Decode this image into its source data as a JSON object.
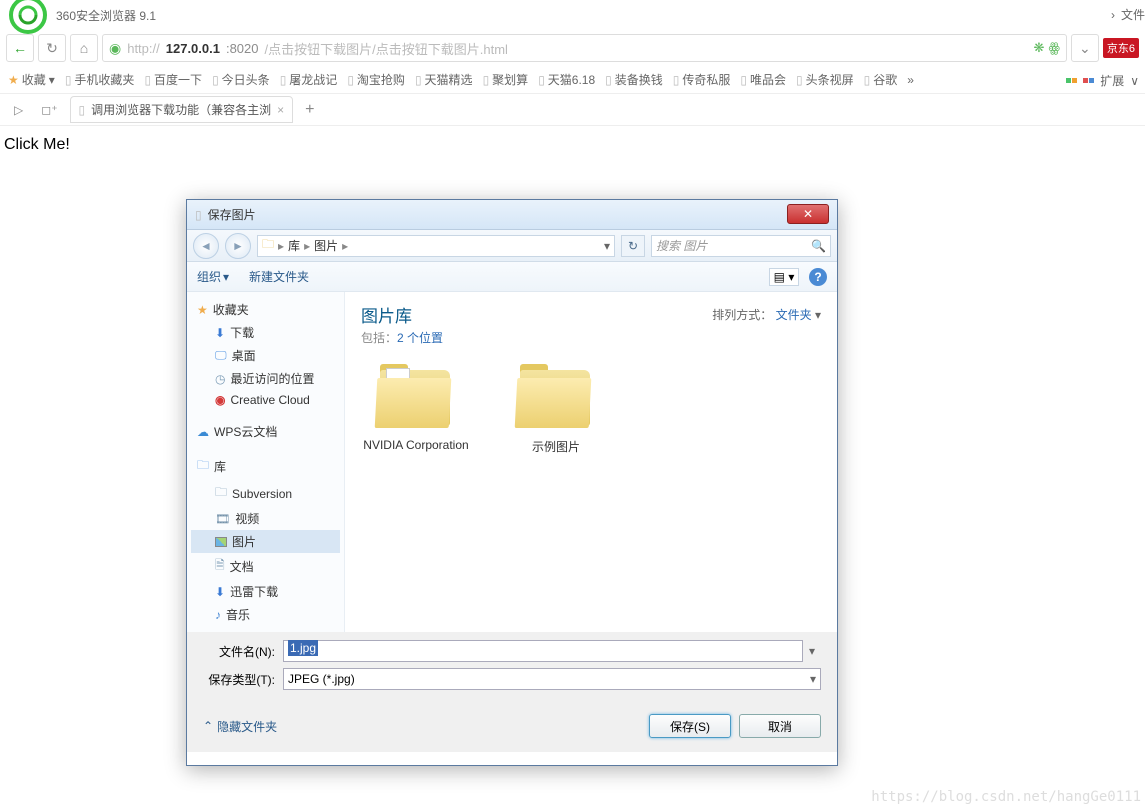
{
  "browser": {
    "title": "360安全浏览器 9.1",
    "top_right_file": "文件",
    "url_prefix": "http://",
    "url_host": "127.0.0.1",
    "url_port": ":8020",
    "url_path": "/点击按钮下载图片/点击按钮下载图片.html",
    "jd_label": "京东6"
  },
  "bookmarks": {
    "fav": "收藏",
    "items": [
      "手机收藏夹",
      "百度一下",
      "今日头条",
      "屠龙战记",
      "淘宝抢购",
      "天猫精选",
      "聚划算",
      "天猫6.18",
      "装备换钱",
      "传奇私服",
      "唯品会",
      "头条视屏",
      "谷歌"
    ],
    "more": "»",
    "ext": "扩展",
    "ext_arrow": "∨"
  },
  "tab": {
    "label": "调用浏览器下载功能（兼容各主浏",
    "new": "+"
  },
  "page": {
    "link": "Click Me!"
  },
  "dialog": {
    "title": "保存图片",
    "breadcrumb": {
      "lib": "库",
      "pics": "图片"
    },
    "search_placeholder": "搜索 图片",
    "tools": {
      "org": "组织",
      "newfolder": "新建文件夹"
    },
    "tree": {
      "fav": "收藏夹",
      "dl": "下载",
      "desk": "桌面",
      "recent": "最近访问的位置",
      "cc": "Creative Cloud",
      "wps": "WPS云文档",
      "lib": "库",
      "sv": "Subversion",
      "video": "视频",
      "pic": "图片",
      "doc": "文档",
      "xl": "迅雷下载",
      "music": "音乐"
    },
    "content": {
      "title": "图片库",
      "sub_prefix": "包括：",
      "sub_link": "2 个位置",
      "sort_label": "排列方式：",
      "sort_value": "文件夹",
      "folders": [
        "NVIDIA Corporation",
        "示例图片"
      ]
    },
    "fields": {
      "name_label": "文件名(N):",
      "name_value": "1.jpg",
      "type_label": "保存类型(T):",
      "type_value": "JPEG (*.jpg)"
    },
    "bottom": {
      "hide": "隐藏文件夹",
      "save": "保存(S)",
      "cancel": "取消"
    }
  },
  "watermark": "https://blog.csdn.net/hangGe0111"
}
